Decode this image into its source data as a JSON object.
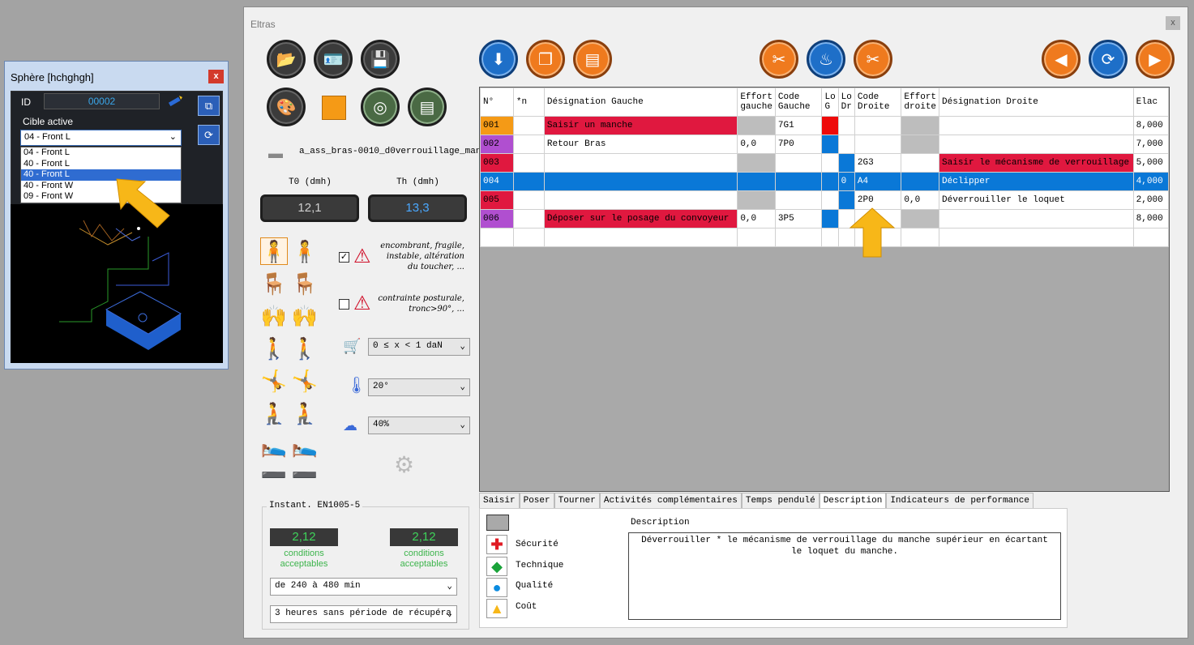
{
  "sphere": {
    "title": "Sphère [hchghgh]",
    "close": "x",
    "id_label": "ID",
    "id_value": "00002",
    "cible_label": "Cible active",
    "selected": "04 - Front L",
    "options": [
      "04 - Front L",
      "40 - Front L",
      "40 - Front L",
      "40 - Front W",
      "09 - Front W"
    ],
    "highlighted_index": 2
  },
  "main": {
    "title": "Eltras",
    "close": "x",
    "file_name": "a_ass_bras-0010_d0verrouillage_man",
    "t0_label": "T0 (dmh)",
    "th_label": "Th (dmh)",
    "t0_value": "12,1",
    "th_value": "13,3",
    "risk1_checked": true,
    "risk1_text": "encombrant, fragile, instable, altération du toucher, ...",
    "risk2_checked": false,
    "risk2_text": "contrainte posturale, tronc>90°, ...",
    "effort_select": "0 ≤ x < 1 daN",
    "temp_select": "20°",
    "humidity_select": "40%",
    "instant_label": "Instant. EN1005-5",
    "score_left": "2,12",
    "score_right": "2,12",
    "cond_left": "conditions acceptables",
    "cond_right": "conditions acceptables",
    "duration_select": "de 240 à 480 min",
    "recovery_select": "3 heures sans période de récupéra",
    "colors": {
      "accent": "#0a78d7",
      "red": "#e0183f",
      "purple": "#b04fd0",
      "orange": "#f59a16"
    }
  },
  "table": {
    "headers": [
      "N°",
      "*n",
      "Désignation Gauche",
      "Effort gauche",
      "Code Gauche",
      "Lo G",
      "Lo Dr",
      "Code Droite",
      "Effort droite",
      "Désignation Droite",
      "Elac"
    ],
    "rows": [
      {
        "n": "001",
        "star": "",
        "dg": "Saisir un manche",
        "eg": "",
        "cg": "7G1",
        "lg": "",
        "ld": "",
        "cd": "",
        "ed": "",
        "dd": "",
        "elac": "8,000"
      },
      {
        "n": "002",
        "star": "",
        "dg": "Retour Bras",
        "eg": "0,0",
        "cg": "7P0",
        "lg": "",
        "ld": "",
        "cd": "",
        "ed": "",
        "dd": "",
        "elac": "7,000"
      },
      {
        "n": "003",
        "star": "",
        "dg": "",
        "eg": "",
        "cg": "",
        "lg": "",
        "ld": "",
        "cd": "2G3",
        "ed": "",
        "dd": "Saisir le mécanisme de verrouillage",
        "elac": "5,000"
      },
      {
        "n": "004",
        "star": "",
        "dg": "",
        "eg": "",
        "cg": "",
        "lg": "",
        "ld": "0",
        "cd": "A4",
        "ed": "",
        "dd": "Déclipper",
        "elac": "4,000"
      },
      {
        "n": "005",
        "star": "",
        "dg": "",
        "eg": "",
        "cg": "",
        "lg": "",
        "ld": "",
        "cd": "2P0",
        "ed": "0,0",
        "dd": "Déverrouiller le loquet",
        "elac": "2,000"
      },
      {
        "n": "006",
        "star": "",
        "dg": "Déposer sur le posage du convoyeur",
        "eg": "0,0",
        "cg": "3P5",
        "lg": "",
        "ld": "",
        "cd": "",
        "ed": "",
        "dd": "",
        "elac": "8,000"
      }
    ]
  },
  "tabs": [
    "Saisir",
    "Poser",
    "Tourner",
    "Activités complémentaires",
    "Temps pendulé",
    "Description",
    "Indicateurs de performance"
  ],
  "active_tab": "Description",
  "legend": [
    "Sécurité",
    "Technique",
    "Qualité",
    "Coût"
  ],
  "description_label": "Description",
  "description_text": "Déverrouiller * le mécanisme de verrouillage du manche supérieur en écartant le loquet du manche."
}
